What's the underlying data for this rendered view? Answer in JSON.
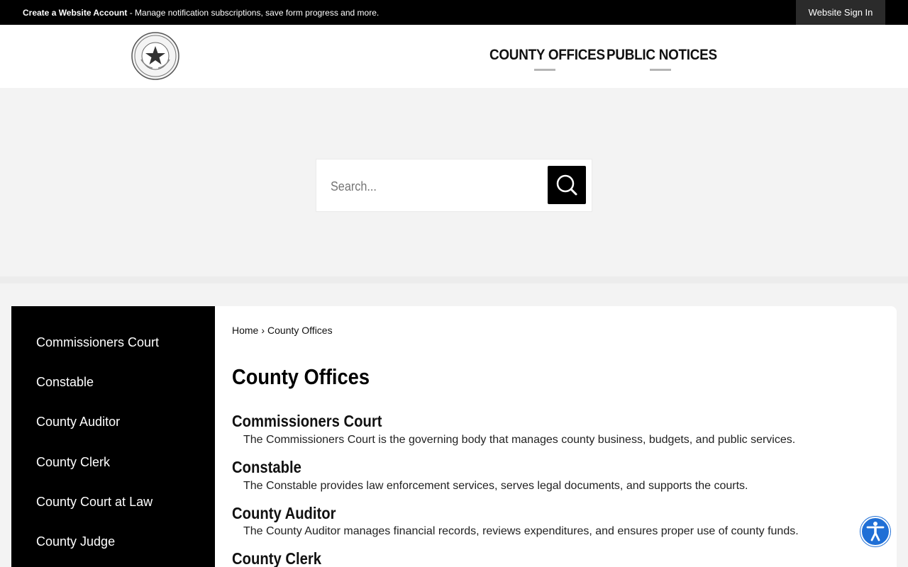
{
  "topbar": {
    "create_account": "Create a Website Account",
    "message": " - Manage notification subscriptions, save form progress and more.",
    "signin": "Website Sign In"
  },
  "header": {
    "nav": [
      "COUNTY OFFICES",
      "PUBLIC NOTICES"
    ]
  },
  "search": {
    "placeholder": "Search..."
  },
  "sidebar": {
    "items": [
      "Commissioners Court",
      "Constable",
      "County Auditor",
      "County Clerk",
      "County Court at Law",
      "County Judge"
    ]
  },
  "breadcrumb": {
    "home": "Home",
    "separator": "›",
    "current": "County Offices"
  },
  "main": {
    "title": "County Offices",
    "entries": [
      {
        "title": "Commissioners Court",
        "desc": "The Commissioners Court is the governing body that manages county business, budgets, and public services."
      },
      {
        "title": "Constable",
        "desc": "The Constable provides law enforcement services, serves legal documents, and supports the courts."
      },
      {
        "title": "County Auditor",
        "desc": "The County Auditor manages financial records, reviews expenditures, and ensures proper use of county funds."
      },
      {
        "title": "County Clerk",
        "desc": ""
      }
    ]
  },
  "icons": {
    "seal": "county-seal-icon",
    "search": "search-icon",
    "accessibility": "accessibility-icon"
  },
  "colors": {
    "topbar": "#000000",
    "sidebar": "#000000",
    "accessibility": "#1f6fd6"
  }
}
